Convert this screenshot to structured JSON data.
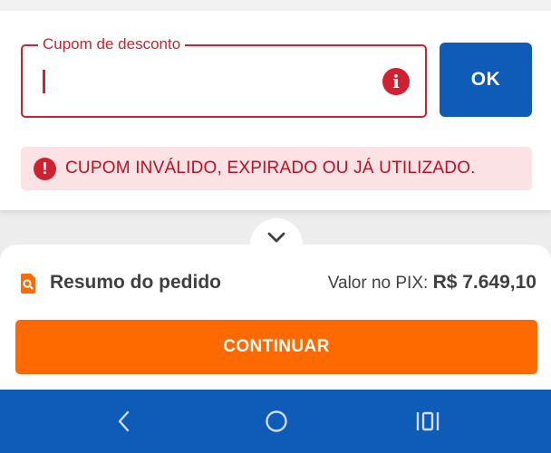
{
  "coupon": {
    "label": "Cupom de desconto",
    "value": "",
    "ok_label": "OK",
    "error_message": "CUPOM INVÁLIDO, EXPIRADO OU JÁ UTILIZADO.",
    "error_icon_glyph": "i",
    "banner_icon_glyph": "!"
  },
  "summary": {
    "title": "Resumo do pedido",
    "pix_label": "Valor no PIX: ",
    "pix_amount": "R$ 7.649,10"
  },
  "actions": {
    "continue_label": "CONTINUAR"
  },
  "icons": {
    "collapse": "chevron-down-icon",
    "summary": "search-document-icon",
    "nav_back": "back-icon",
    "nav_home": "home-icon",
    "nav_recents": "recents-icon"
  },
  "colors": {
    "error": "#d1202f",
    "error_bg": "#fbe3e5",
    "primary_blue": "#0f5bb8",
    "accent_orange": "#ff6a00"
  }
}
